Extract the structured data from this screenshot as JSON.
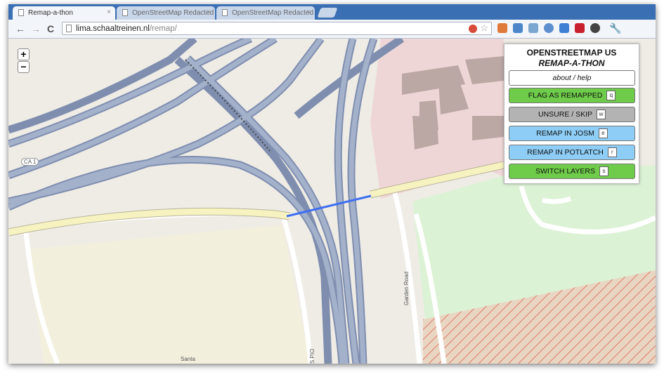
{
  "tabs": [
    {
      "title": "Remap-a-thon",
      "active": true
    },
    {
      "title": "OpenStreetMap Redacted",
      "active": false
    },
    {
      "title": "OpenStreetMap Redacted",
      "active": false
    }
  ],
  "address": {
    "host": "lima.schaaltreinen.nl",
    "path": "/remap/"
  },
  "nav": {
    "back": "←",
    "forward": "→",
    "reload": "C"
  },
  "zoom": {
    "in": "+",
    "out": "−"
  },
  "panel": {
    "title_line1": "OPENSTREETMAP US",
    "title_line2": "REMAP-A-THON",
    "about": "about / help",
    "buttons": [
      {
        "label": "FLAG AS REMAPPED",
        "key": "q",
        "color": "#6fcc4a"
      },
      {
        "label": "UNSURE / SKIP",
        "key": "w",
        "color": "#b3b3b3"
      },
      {
        "label": "REMAP IN JOSM",
        "key": "e",
        "color": "#8ecdf5"
      },
      {
        "label": "REMAP IN POTLATCH",
        "key": "r",
        "color": "#8ecdf5"
      },
      {
        "label": "SWITCH LAYERS",
        "key": "s",
        "color": "#6fcc4a"
      }
    ]
  },
  "map_labels": {
    "ca1": "CA 1",
    "garden_road": "Garden Road",
    "santa": "Santa",
    "s_pio": "S PIO"
  }
}
